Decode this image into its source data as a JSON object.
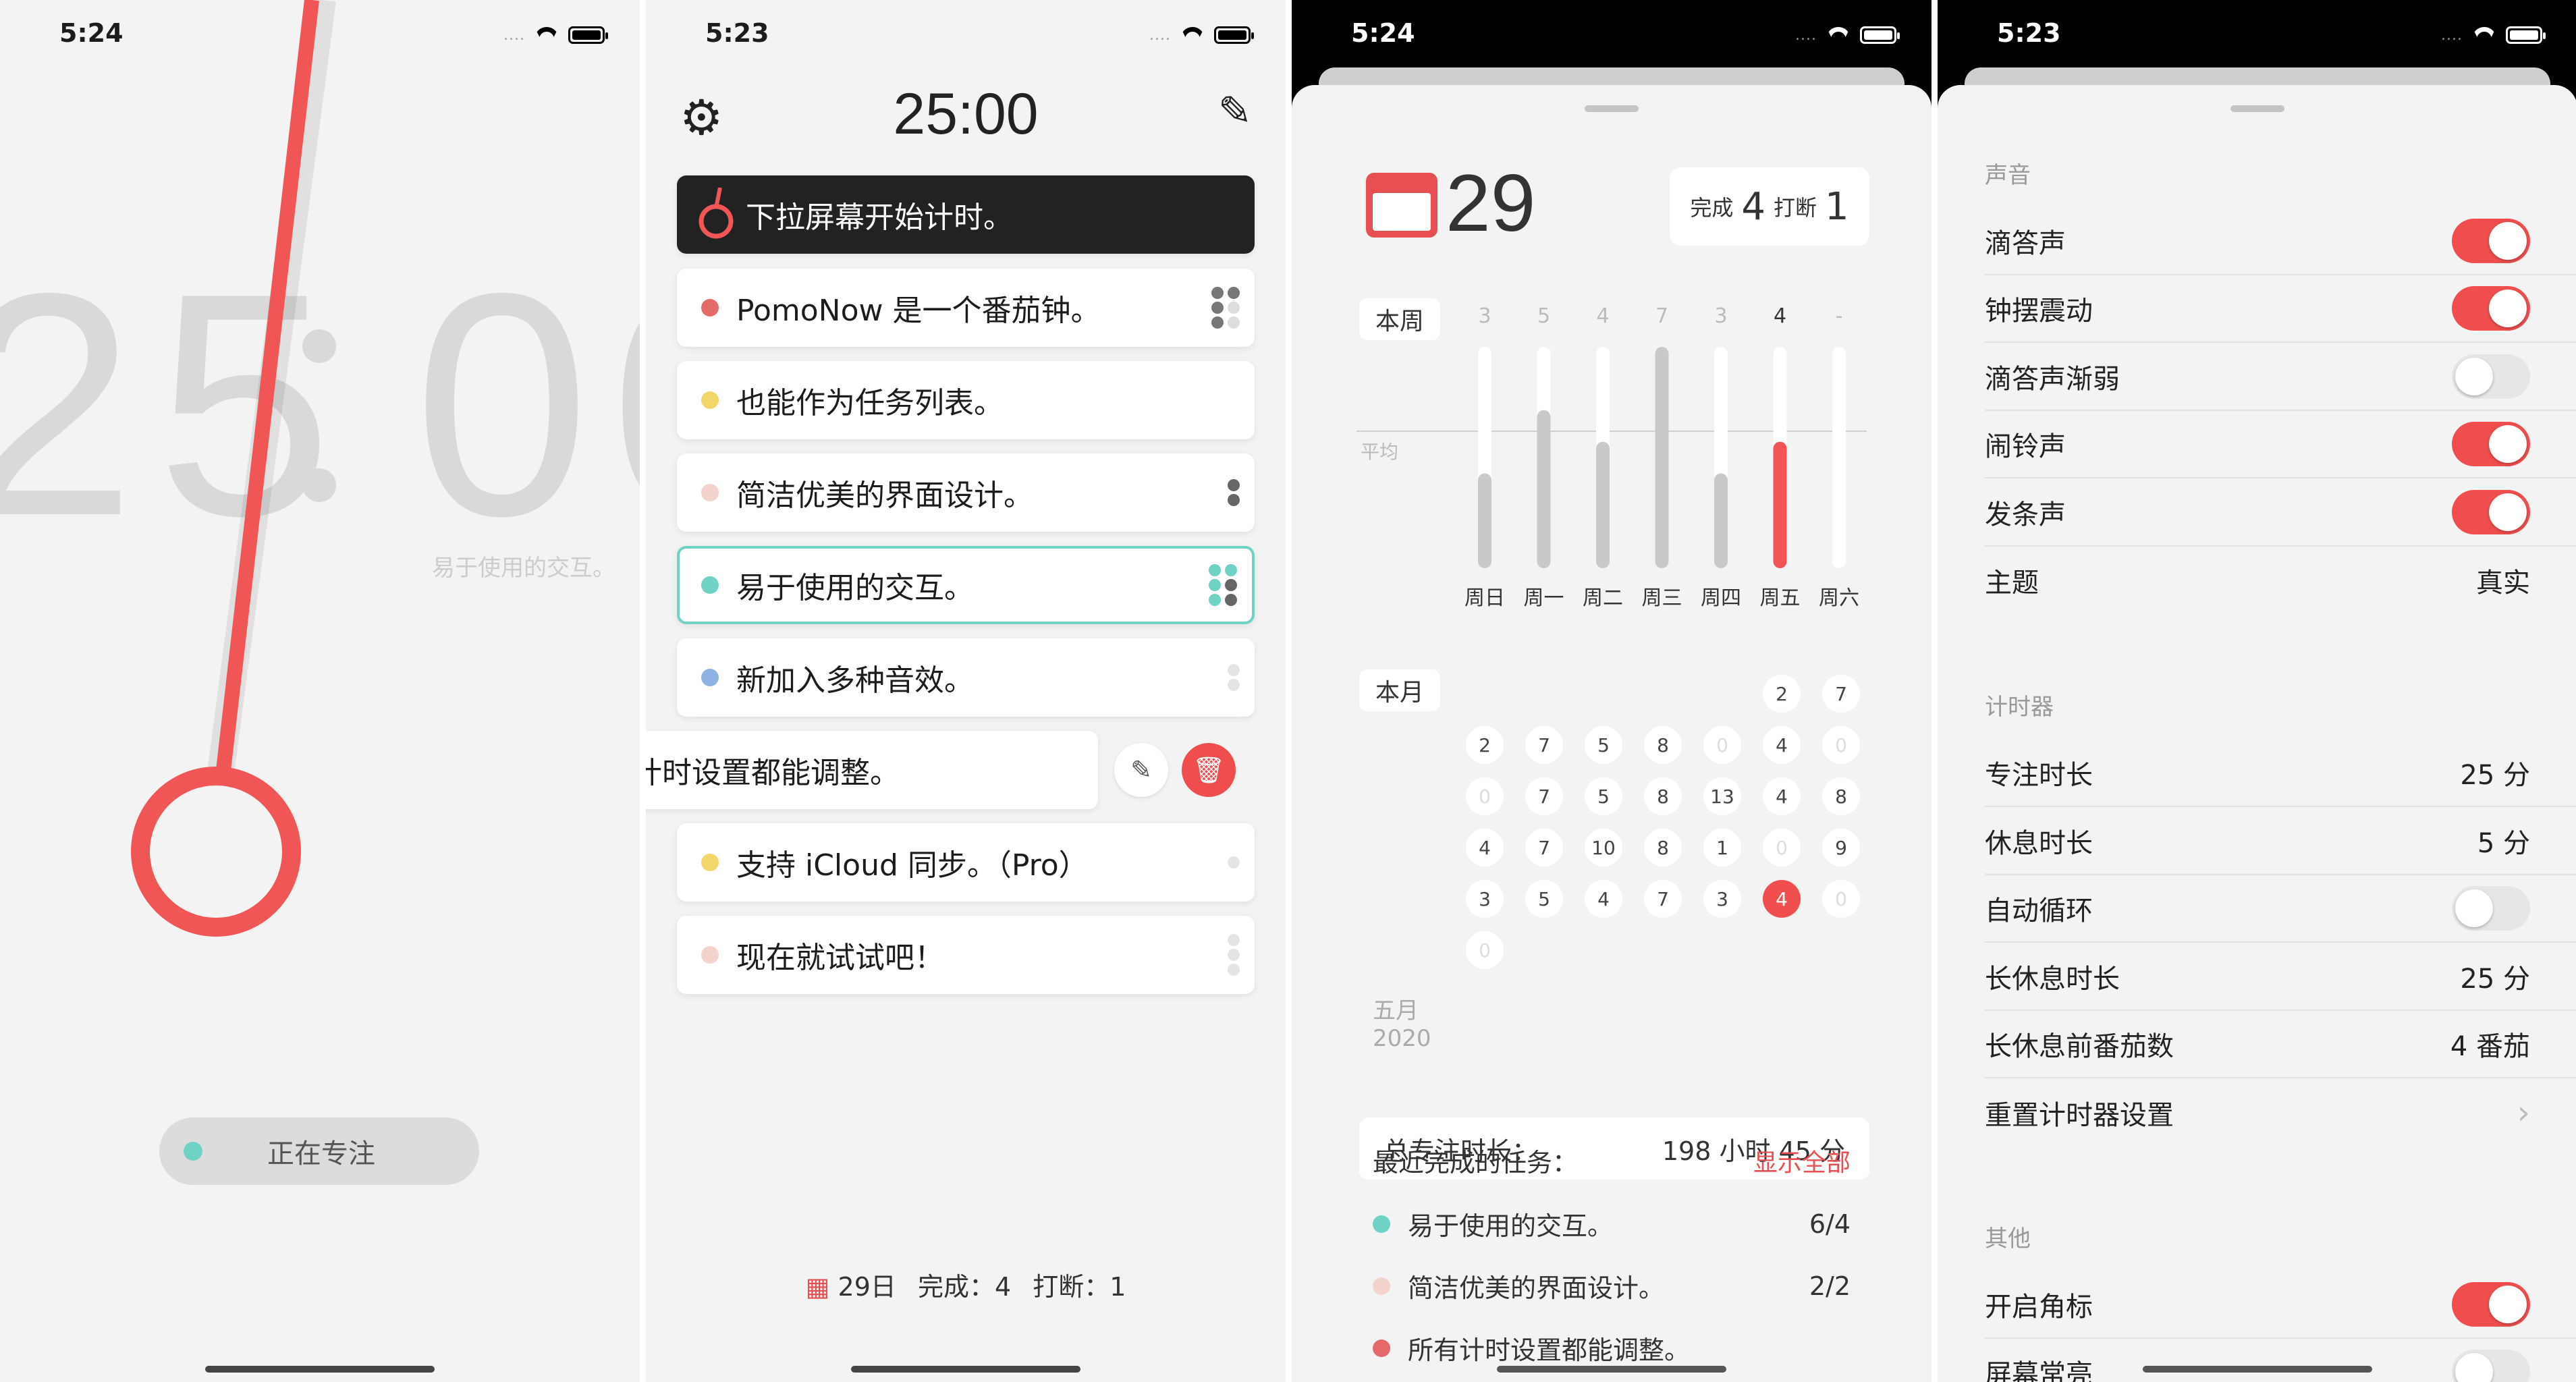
{
  "screens": {
    "focus": {
      "time": "5:24",
      "big_left": "25",
      "big_right": "00",
      "hint": "易于使用的交互。",
      "button": "正在专注"
    },
    "list": {
      "time": "5:23",
      "timer": "25:00",
      "tasks": [
        {
          "text": "下拉屏幕开始计时。"
        },
        {
          "text": "PomoNow 是一个番茄钟。",
          "color": "#e46a6a"
        },
        {
          "text": "也能作为任务列表。",
          "color": "#f2d66a"
        },
        {
          "text": "简洁优美的界面设计。",
          "color": "#f4d3cc"
        },
        {
          "text": "易于使用的交互。",
          "color": "#6fd2c4"
        },
        {
          "text": "新加入多种音效。",
          "color": "#8fb2e4"
        },
        {
          "text": "计时设置都能调整。"
        },
        {
          "text": "支持 iCloud 同步。（Pro）",
          "color": "#f2d66a"
        },
        {
          "text": "现在就试试吧！",
          "color": "#f4d3cc"
        }
      ],
      "bottom": {
        "day": "29日",
        "done_label": "完成：",
        "done": "4",
        "intr_label": "打断：",
        "intr": "1"
      }
    },
    "stats": {
      "time": "5:24",
      "day": "29",
      "done_label": "完成",
      "done": "4",
      "intr_label": "打断",
      "intr": "1",
      "week_label": "本周",
      "avg_label": "平均",
      "week_counts": [
        "3",
        "5",
        "4",
        "7",
        "3",
        "4",
        "-"
      ],
      "week_days": [
        "周日",
        "周一",
        "周二",
        "周三",
        "周四",
        "周五",
        "周六"
      ],
      "week_values": [
        3,
        5,
        4,
        7,
        3,
        4,
        0
      ],
      "month_label": "本月",
      "month_name": "五月",
      "year": "2020",
      "month_rows": [
        [
          "",
          "",
          "",
          "",
          "",
          "2",
          "7"
        ],
        [
          "2",
          "7",
          "5",
          "8",
          "0",
          "4",
          "0"
        ],
        [
          "0",
          "7",
          "5",
          "8",
          "13",
          "4",
          "8"
        ],
        [
          "4",
          "7",
          "10",
          "8",
          "1",
          "0",
          "9"
        ],
        [
          "3",
          "5",
          "4",
          "7",
          "3",
          "4",
          "0"
        ],
        [
          "0",
          "",
          "",
          "",
          "",
          "",
          ""
        ]
      ],
      "total_label": "总专注时长：",
      "total_value": "198 小时 45 分",
      "recent_title": "最近完成的任务：",
      "show_all": "显示全部",
      "recent": [
        {
          "text": "易于使用的交互。",
          "val": "6/4",
          "color": "#6fd2c4"
        },
        {
          "text": "简洁优美的界面设计。",
          "val": "2/2",
          "color": "#f4d3cc"
        },
        {
          "text": "所有计时设置都能调整。",
          "val": "",
          "color": "#e46a6a"
        }
      ]
    },
    "settings": {
      "time": "5:23",
      "sound_title": "声音",
      "sound": [
        {
          "label": "滴答声",
          "toggle": true
        },
        {
          "label": "钟摆震动",
          "toggle": true
        },
        {
          "label": "滴答声渐弱",
          "toggle": false
        },
        {
          "label": "闹铃声",
          "toggle": true
        },
        {
          "label": "发条声",
          "toggle": true
        }
      ],
      "theme_label": "主题",
      "theme_value": "真实",
      "timer_title": "计时器",
      "timer": [
        {
          "label": "专注时长",
          "value": "25 分"
        },
        {
          "label": "休息时长",
          "value": "5 分"
        },
        {
          "label": "自动循环",
          "toggle": false
        },
        {
          "label": "长休息时长",
          "value": "25 分"
        },
        {
          "label": "长休息前番茄数",
          "value": "4 番茄"
        },
        {
          "label": "重置计时器设置",
          "chevron": true
        }
      ],
      "other_title": "其他",
      "other": [
        {
          "label": "开启角标",
          "toggle": true
        },
        {
          "label": "屏幕常亮",
          "toggle": false
        }
      ]
    }
  }
}
